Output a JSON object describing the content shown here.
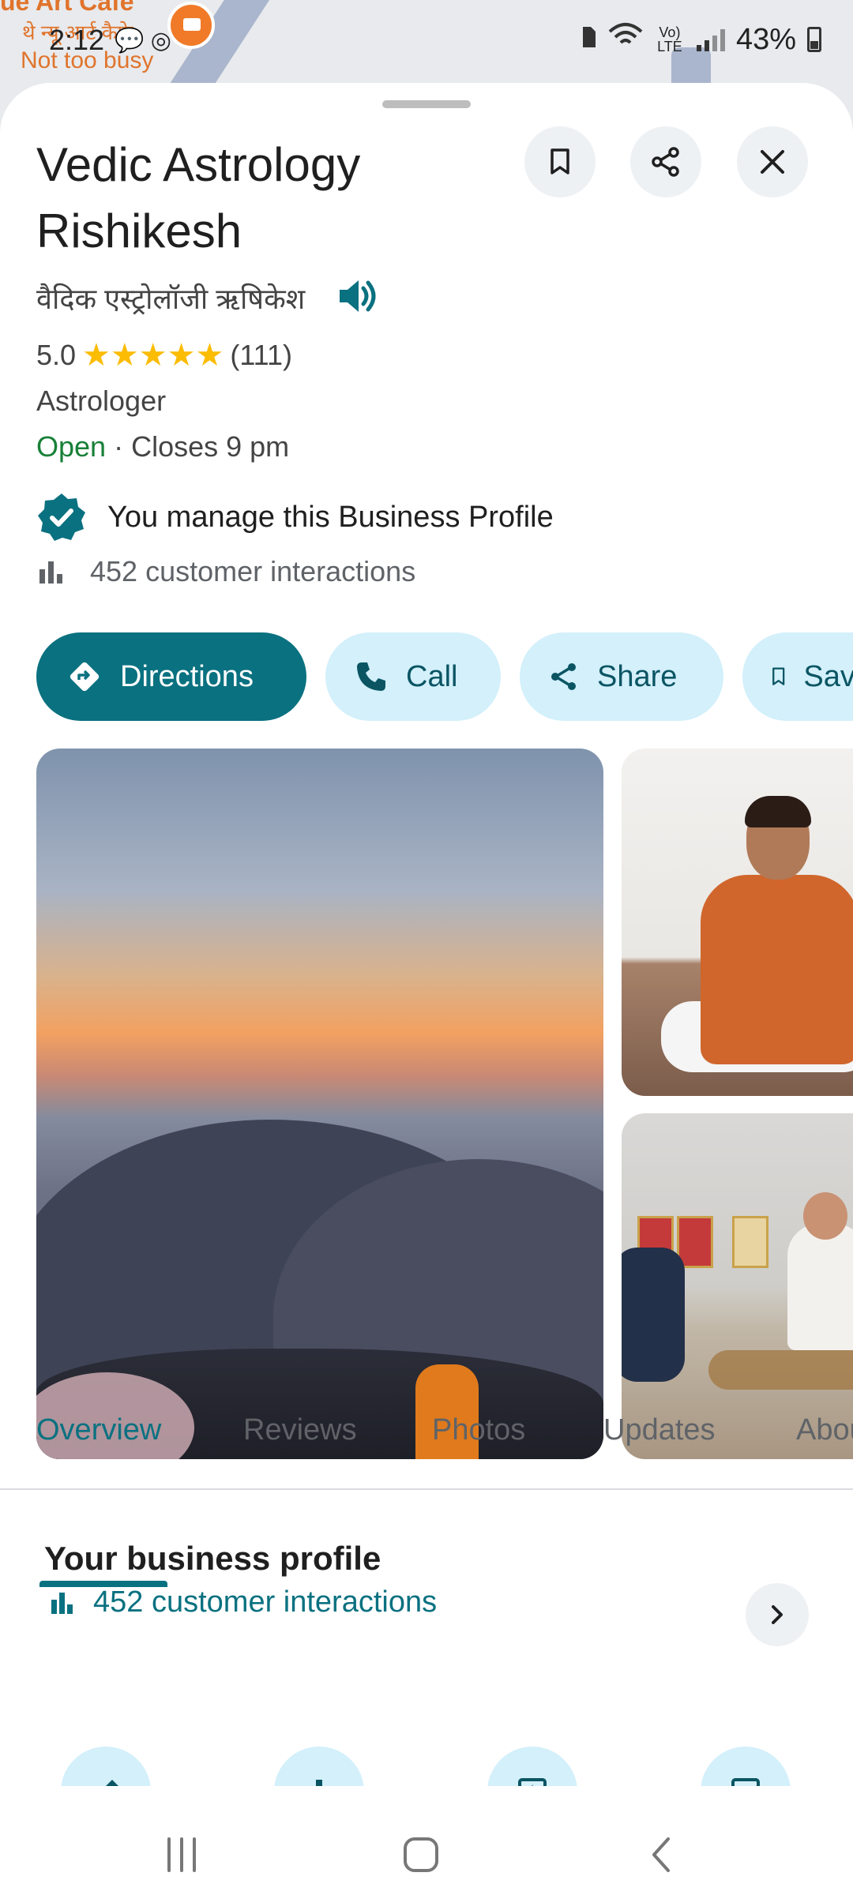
{
  "map": {
    "label_top": "ue Art Cafe",
    "label_hindi": "थे न्यू आर्ट कैफे",
    "busy_text": "Not too busy"
  },
  "status_bar": {
    "time": "2:12",
    "notification_icons": "💬 ◎",
    "volte": "Vo) LTE",
    "battery_percent": "43%"
  },
  "place": {
    "name": "Vedic Astrology Rishikesh",
    "name_local": "वैदिक एस्ट्रोलॉजी ऋषिकेश",
    "rating": "5.0",
    "stars": "★★★★★",
    "review_count": "(111)",
    "category": "Astrologer",
    "open_status": "Open",
    "hours_text": " · Closes 9 pm",
    "managed_text": "You manage this Business Profile",
    "interactions_text": "452 customer interactions"
  },
  "actions": {
    "directions": "Directions",
    "call": "Call",
    "share": "Share",
    "save": "Save"
  },
  "tabs": [
    "Overview",
    "Reviews",
    "Photos",
    "Updates",
    "About"
  ],
  "business_profile": {
    "title": "Your business profile",
    "interactions": "452 customer interactions"
  },
  "colors": {
    "accent": "#0a7180",
    "chip_bg": "#d3f0fb",
    "open_green": "#188038",
    "star": "#fbbc04"
  },
  "icons": [
    "bookmark-icon",
    "share-icon",
    "close-icon",
    "speaker-icon",
    "verified-badge-icon",
    "bar-chart-icon",
    "directions-icon",
    "phone-icon",
    "chevron-right-icon"
  ]
}
